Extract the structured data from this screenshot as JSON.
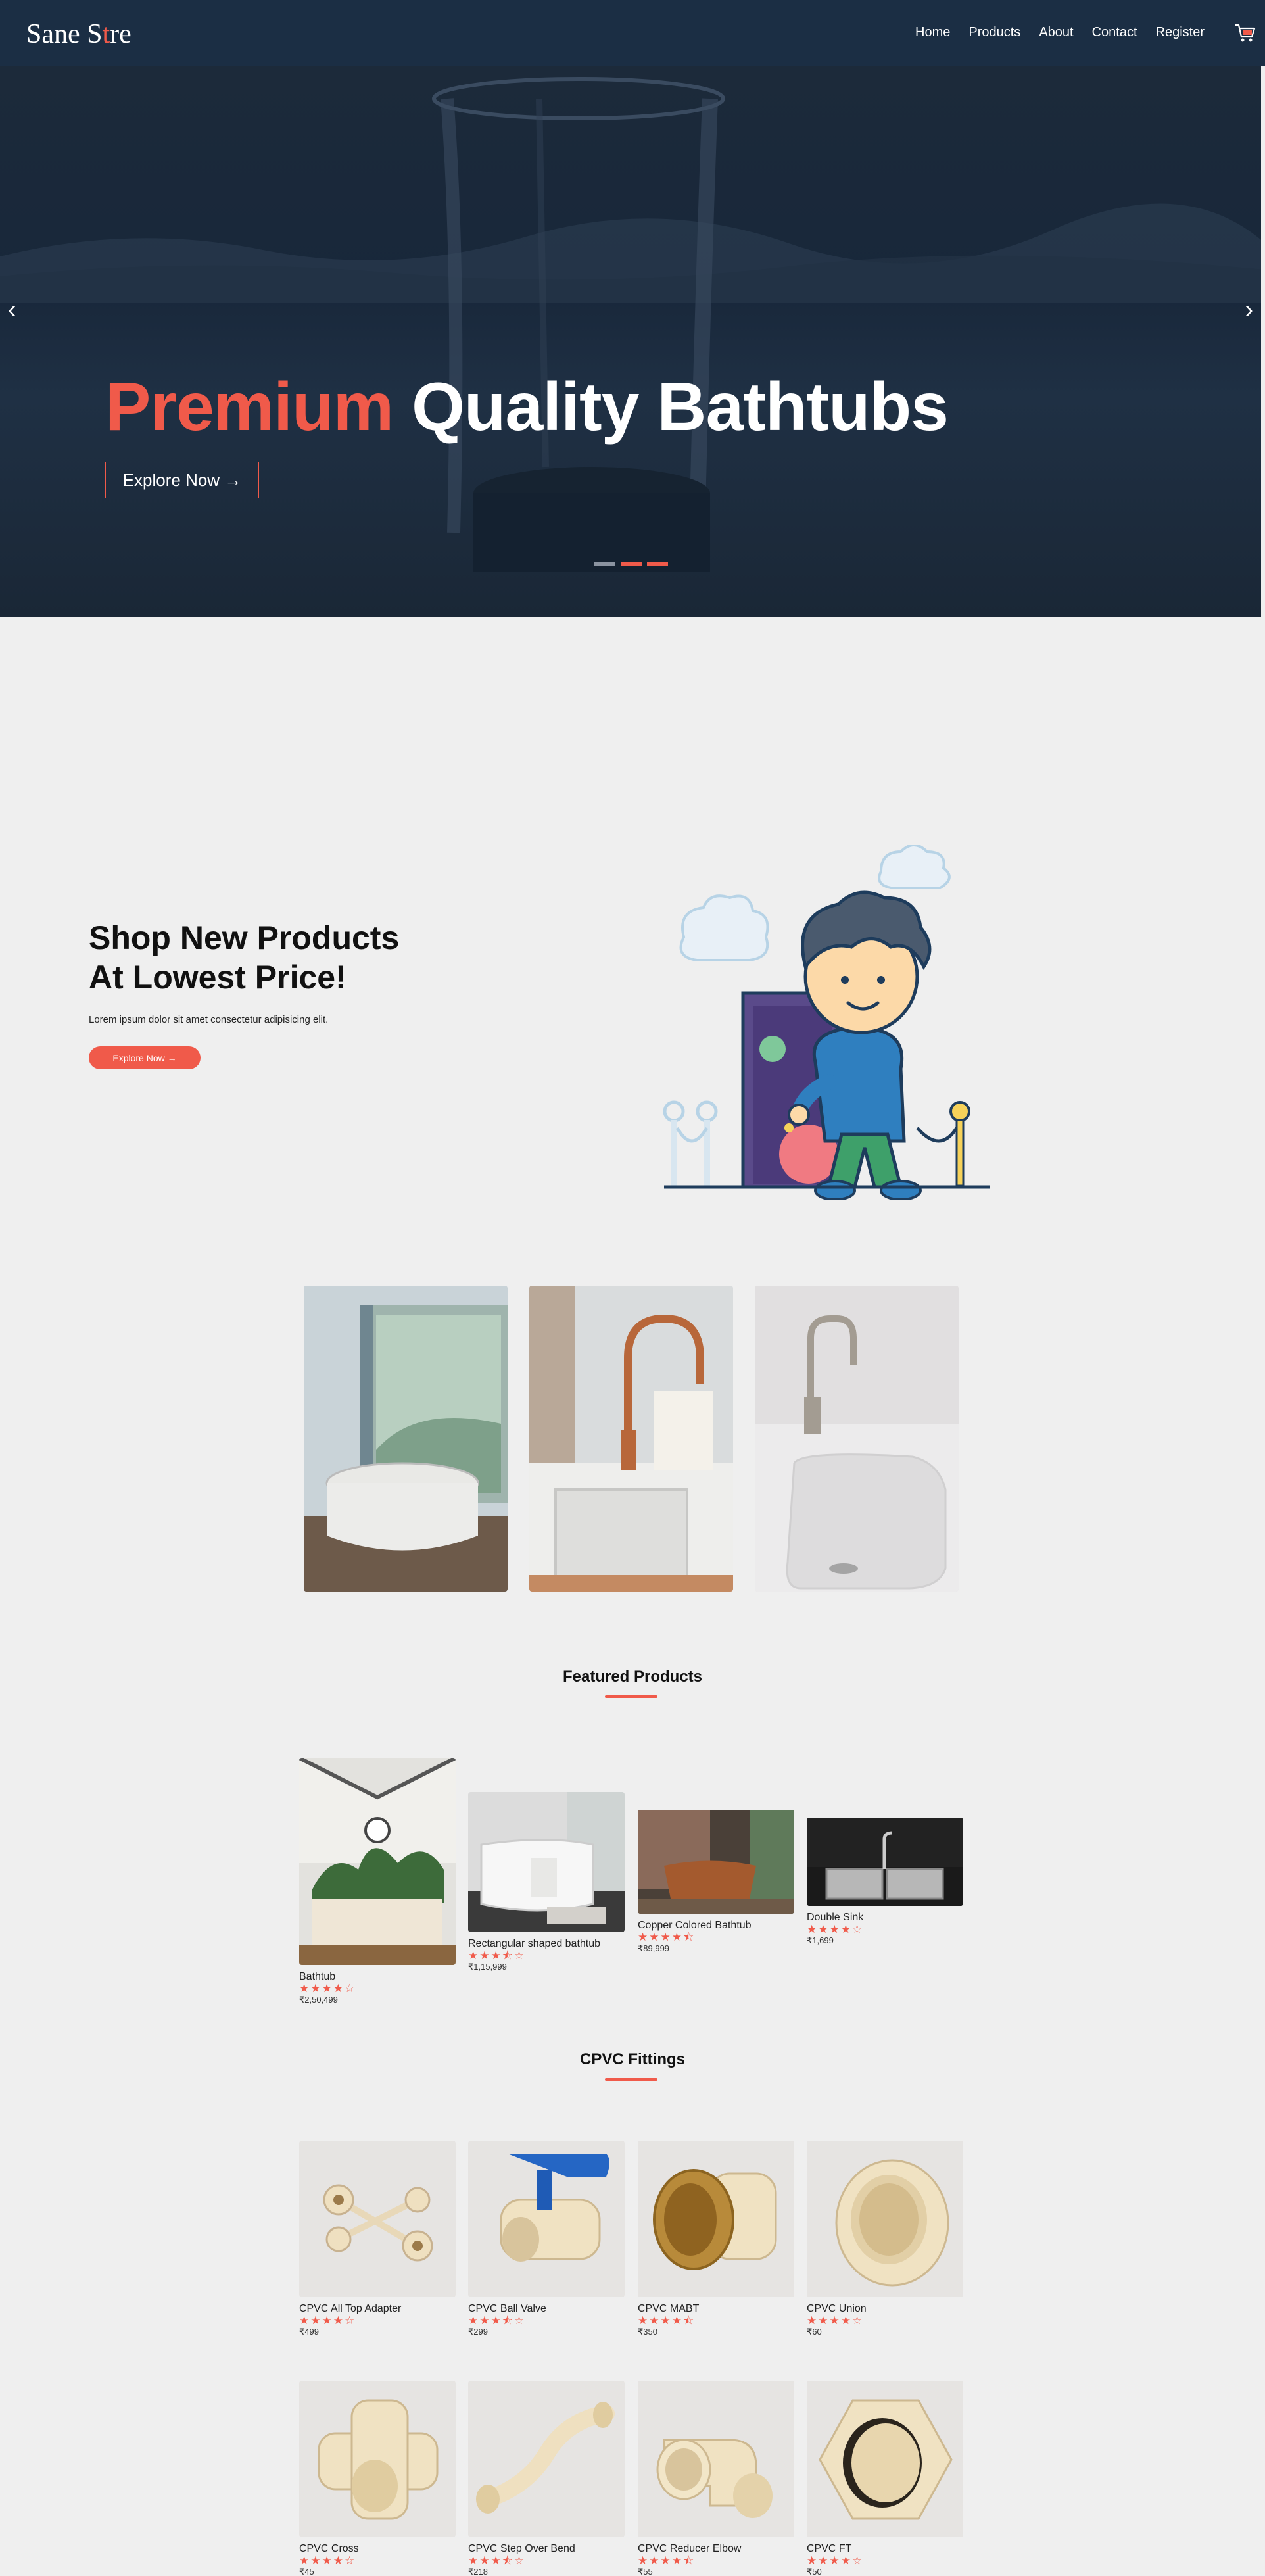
{
  "nav": {
    "logo_pre": "Sane S",
    "logo_o": "t",
    "logo_post": "re",
    "links": [
      "Home",
      "Products",
      "About",
      "Contact",
      "Register"
    ]
  },
  "hero": {
    "title_accent": "Premium",
    "title_rest": "Quality Bathtubs",
    "button": "Explore Now →",
    "prev": "‹",
    "next": "›",
    "slides": 3,
    "active_slide": 2
  },
  "shop": {
    "title_line1": "Shop New Products",
    "title_line2": "At Lowest Price!",
    "description": "Lorem ipsum dolor sit amet consectetur adipisicing elit.",
    "button": "Explore Now →"
  },
  "featured": {
    "title": "Featured Products",
    "products": [
      {
        "name": "Bathtub",
        "rating": 4,
        "price": "₹2,50,499"
      },
      {
        "name": "Rectangular shaped bathtub",
        "rating": 3.5,
        "price": "₹1,15,999"
      },
      {
        "name": "Copper Colored Bathtub",
        "rating": 4.5,
        "price": "₹89,999"
      },
      {
        "name": "Double Sink",
        "rating": 4,
        "price": "₹1,699"
      }
    ]
  },
  "cpvc": {
    "title": "CPVC Fittings",
    "products": [
      {
        "name": "CPVC All Top Adapter",
        "rating": 4,
        "price": "₹499"
      },
      {
        "name": "CPVC Ball Valve",
        "rating": 3.5,
        "price": "₹299"
      },
      {
        "name": "CPVC MABT",
        "rating": 4.5,
        "price": "₹350"
      },
      {
        "name": "CPVC Union",
        "rating": 4,
        "price": "₹60"
      },
      {
        "name": "CPVC Cross",
        "rating": 4,
        "price": "₹45"
      },
      {
        "name": "CPVC Step Over Bend",
        "rating": 3.5,
        "price": "₹218"
      },
      {
        "name": "CPVC Reducer Elbow",
        "rating": 4.5,
        "price": "₹55"
      },
      {
        "name": "CPVC FT",
        "rating": 4,
        "price": "₹50"
      }
    ]
  },
  "colors": {
    "accent": "#f05a4a",
    "nav_bg": "#1b2e44",
    "page_bg": "#efefef"
  }
}
